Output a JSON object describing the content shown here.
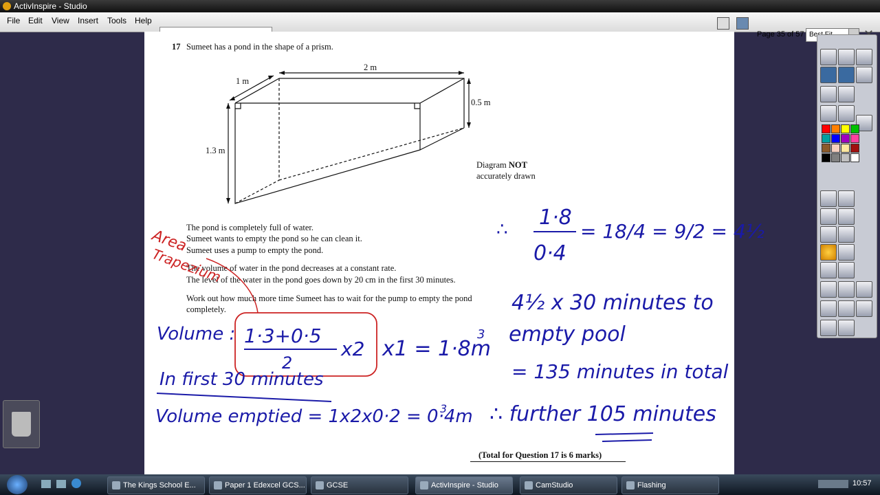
{
  "window": {
    "title": "ActivInspire - Studio"
  },
  "menu": [
    "File",
    "Edit",
    "View",
    "Insert",
    "Tools",
    "Help"
  ],
  "doc_tab": {
    "label": "1) June 2013 Paper 1 (NC)"
  },
  "toolbar": {
    "page_label": "Page 35 of 57",
    "zoom_value": "Best Fit"
  },
  "question": {
    "number": "17",
    "intro": "Sumeet has a pond in the shape of a prism.",
    "dims": {
      "length": "2 m",
      "width": "1 m",
      "shallow_depth": "0.5 m",
      "deep_depth": "1.3 m"
    },
    "diagram_note_1": "Diagram ",
    "diagram_note_bold": "NOT",
    "diagram_note_2": "accurately drawn",
    "lines": [
      "The pond is completely full of water.",
      "Sumeet wants to empty the pond so he can clean it.",
      "Sumeet uses a pump to empty the pond.",
      "The volume of water in the pond decreases at a constant rate.",
      "The level of the water in the pond goes down by 20 cm in the first 30 minutes.",
      "Work out how much more time Sumeet has to wait for the pump to empty the pond",
      "completely."
    ],
    "total": "(Total for Question 17 is 6 marks)"
  },
  "handwriting": {
    "area_word": "Area",
    "trapezium_word": "Trapezium",
    "volume_label": "Volume :",
    "frac_num": "1·3+0·5",
    "frac_den": "2",
    "times_two": "x2",
    "times_one": "x1 = 1·8m",
    "cube": "3",
    "first_30": "In first 30 minutes",
    "volume_emptied": "Volume emptied = 1x2x0·2 = 0·4m",
    "therefore": "∴",
    "ratio_num": "1·8",
    "ratio_den": "0·4",
    "ratio_eq": "= 18/4 = 9/2 = 4½",
    "line1": "4½ x 30 minutes to",
    "line2": "empty pool",
    "line3": "= 135 minutes in total",
    "line4": "∴ further 105 minutes"
  },
  "palette": {
    "colors": [
      "#ff0000",
      "#ff8000",
      "#ffff00",
      "#00c000",
      "#00a0a0",
      "#0000ff",
      "#a000c0",
      "#ff40a0",
      "#8b5a2b",
      "#f5d0c0",
      "#ffe8a0",
      "#a01010",
      "#000000",
      "#808080",
      "#c0c0c0",
      "#ffffff"
    ]
  },
  "taskbar": {
    "items": [
      "The Kings School E...",
      "Paper 1 Edexcel GCS...",
      "GCSE",
      "ActivInspire - Studio",
      "CamStudio",
      "Flashing"
    ],
    "clock": "10:57"
  }
}
